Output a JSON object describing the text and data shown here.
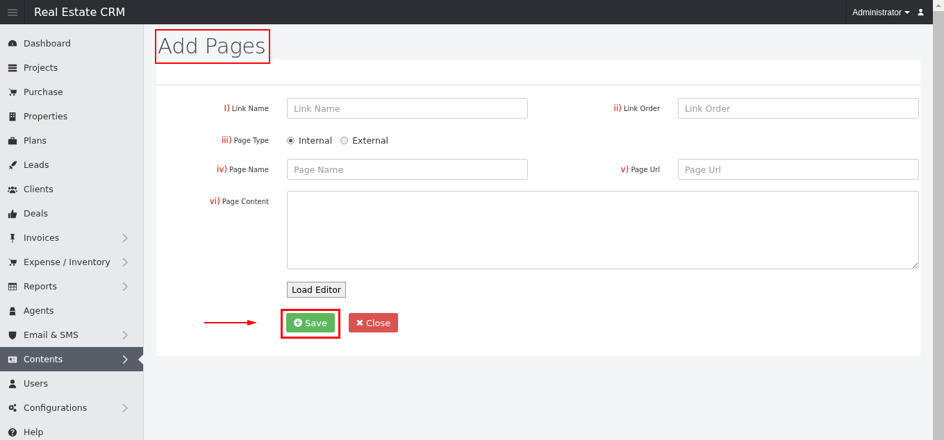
{
  "app": {
    "title": "Real Estate CRM",
    "user": "Administrator"
  },
  "sidebar": {
    "items": [
      {
        "label": "Dashboard",
        "has_submenu": false,
        "selected": false
      },
      {
        "label": "Projects",
        "has_submenu": false,
        "selected": false
      },
      {
        "label": "Purchase",
        "has_submenu": false,
        "selected": false
      },
      {
        "label": "Properties",
        "has_submenu": false,
        "selected": false
      },
      {
        "label": "Plans",
        "has_submenu": false,
        "selected": false
      },
      {
        "label": "Leads",
        "has_submenu": false,
        "selected": false
      },
      {
        "label": "Clients",
        "has_submenu": false,
        "selected": false
      },
      {
        "label": "Deals",
        "has_submenu": false,
        "selected": false
      },
      {
        "label": "Invoices",
        "has_submenu": true,
        "selected": false
      },
      {
        "label": "Expense / Inventory",
        "has_submenu": true,
        "selected": false
      },
      {
        "label": "Reports",
        "has_submenu": true,
        "selected": false
      },
      {
        "label": "Agents",
        "has_submenu": false,
        "selected": false
      },
      {
        "label": "Email & SMS",
        "has_submenu": true,
        "selected": false
      },
      {
        "label": "Contents",
        "has_submenu": true,
        "selected": true
      },
      {
        "label": "Users",
        "has_submenu": false,
        "selected": false
      },
      {
        "label": "Configurations",
        "has_submenu": true,
        "selected": false
      },
      {
        "label": "Help",
        "has_submenu": false,
        "selected": false
      }
    ]
  },
  "page": {
    "title": "Add Pages",
    "highlighted": true
  },
  "form": {
    "rows": [
      [
        {
          "kind": "text",
          "marker": "I)",
          "label": "Link Name",
          "placeholder": "Link Name"
        },
        {
          "kind": "text",
          "marker": "ii)",
          "label": "Link Order",
          "placeholder": "Link Order"
        }
      ],
      [
        {
          "kind": "radio",
          "marker": "iii)",
          "label": "Page Type",
          "options": [
            {
              "label": "Internal",
              "selected": true
            },
            {
              "label": "External",
              "selected": false
            }
          ]
        }
      ],
      [
        {
          "kind": "text",
          "marker": "iv)",
          "label": "Page Name",
          "placeholder": "Page Name"
        },
        {
          "kind": "text",
          "marker": "v)",
          "label": "Page Url",
          "placeholder": "Page Url"
        }
      ],
      [
        {
          "kind": "textarea",
          "marker": "vi)",
          "label": "Page Content"
        }
      ]
    ],
    "load_editor": "Load Editor",
    "actions": [
      {
        "kind": "save",
        "label": "Save",
        "highlighted": true
      },
      {
        "kind": "close",
        "label": "Close",
        "highlighted": false
      }
    ]
  }
}
